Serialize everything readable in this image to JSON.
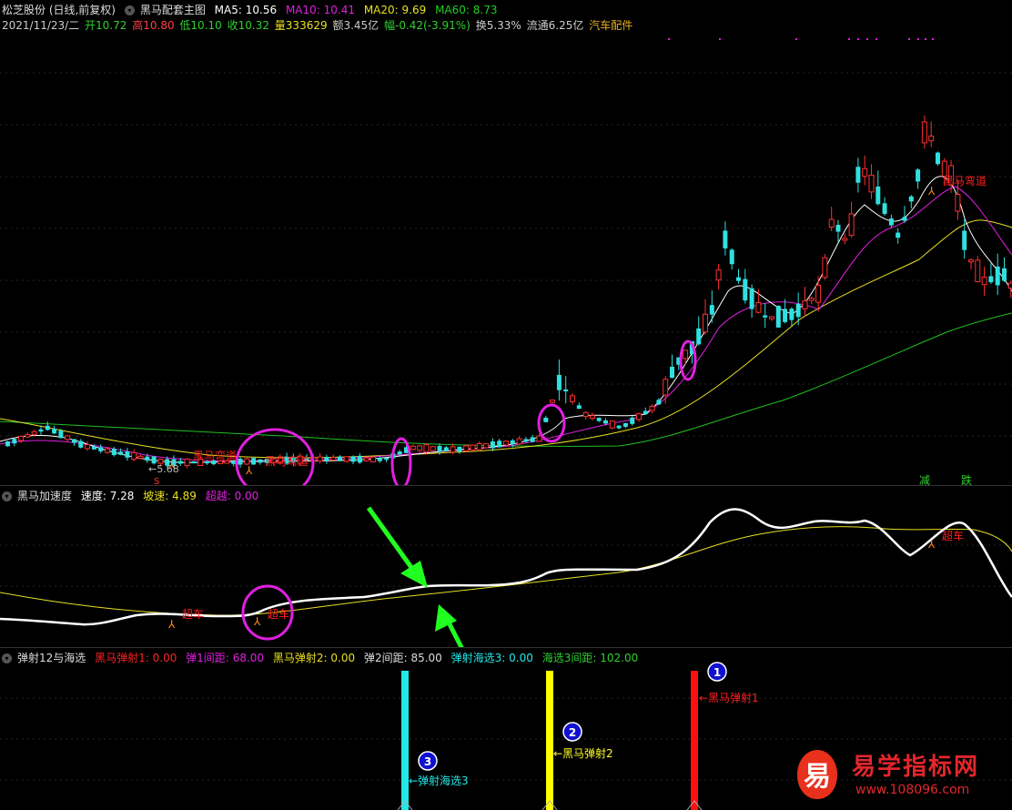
{
  "main_header": {
    "stock": "松芝股份 (日线,前复权)",
    "indicator": "黑马配套主图",
    "ma5_label": "MA5:",
    "ma5": "10.56",
    "ma10_label": "MA10:",
    "ma10": "10.41",
    "ma20_label": "MA20:",
    "ma20": "9.69",
    "ma60_label": "MA60:",
    "ma60": "8.73"
  },
  "quote": {
    "date": "2021/11/23/二",
    "open": "开10.72",
    "high": "高10.80",
    "low": "低10.10",
    "close": "收10.32",
    "volume": "量333629",
    "amount": "额3.45亿",
    "change": "幅-0.42(-3.91%)",
    "turnover": "换5.33%",
    "float": "流通6.25亿",
    "sector": "汽车配件"
  },
  "main_chart": {
    "low_price_label": "←5.68",
    "signal_labels": [
      "黑马弯道",
      "黑马弯道",
      "黑马弯道"
    ],
    "bottom_markers": [
      "减",
      "跌"
    ],
    "s_marker": "S"
  },
  "speed_header": {
    "title": "黑马加速度",
    "speed_label": "速度:",
    "speed": "7.28",
    "slope_label": "坡速:",
    "slope": "4.89",
    "over_label": "超越:",
    "over": "0.00"
  },
  "speed_chart": {
    "labels": [
      "超车",
      "超车",
      "超车"
    ]
  },
  "launch_header": {
    "title": "弹射12与海选",
    "l1_label": "黑马弹射1:",
    "l1": "0.00",
    "d1_label": "弹1间距:",
    "d1": "68.00",
    "l2_label": "黑马弹射2:",
    "l2": "0.00",
    "d2_label": "弹2间距:",
    "d2": "85.00",
    "l3_label": "弹射海选3:",
    "l3": "0.00",
    "d3_label": "海选3间距:",
    "d3": "102.00"
  },
  "launch_chart": {
    "bars": [
      {
        "num": "1",
        "label": "←黑马弹射1",
        "color": "#ff1010"
      },
      {
        "num": "2",
        "label": "←黑马弹射2",
        "color": "#ffff00"
      },
      {
        "num": "3",
        "label": "←弹射海选3",
        "color": "#22e8e8"
      }
    ]
  },
  "watermark": {
    "badge": "易",
    "name": "易学指标网",
    "url": "www.108096.com"
  },
  "colors": {
    "ma5": "#ffffff",
    "ma10": "#e020e0",
    "ma20": "#e8e020",
    "ma60": "#20c020",
    "up": "#ff3030",
    "down": "#30e0e0",
    "highlight": "#e020e0",
    "arrow": "#20ff20"
  }
}
